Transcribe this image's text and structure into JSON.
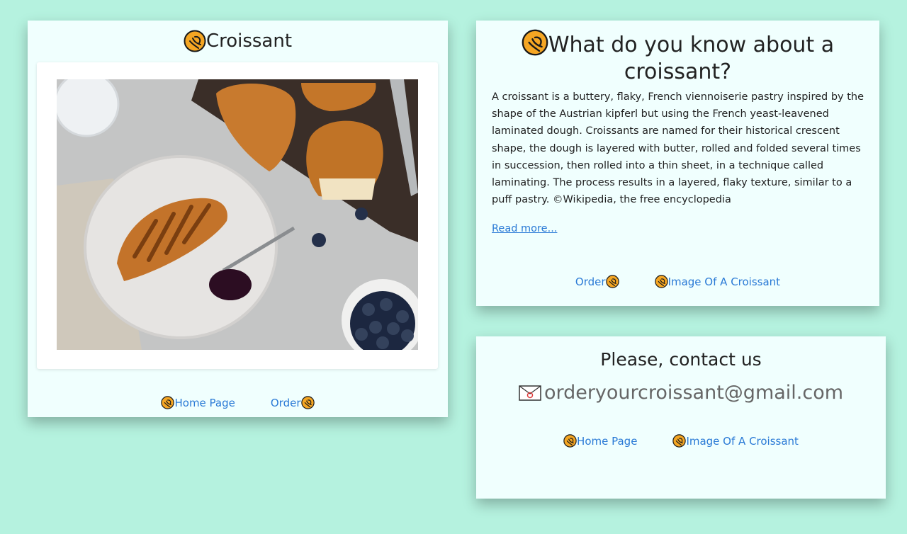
{
  "image_card": {
    "title": "Croissant",
    "links": {
      "home": "Home Page",
      "order": "Order"
    }
  },
  "info_card": {
    "title": "What do you know about a croissant?",
    "description": "A croissant is a buttery, flaky, French viennoiserie pastry inspired by the shape of the Austrian kipferl but using the French yeast-leavened laminated dough. Croissants are named for their historical crescent shape, the dough is layered with butter, rolled and folded several times in succession, then rolled into a thin sheet, in a technique called laminating. The process results in a layered, flaky texture, similar to a puff pastry. ©Wikipedia, the free encyclopedia",
    "read_more": "Read more...",
    "links": {
      "order": "Order",
      "image": "Image Of A Croissant"
    }
  },
  "contact_card": {
    "title": "Please, contact us",
    "email": "orderyourcroissant@gmail.com",
    "links": {
      "home": "Home Page",
      "image": "Image Of A Croissant"
    }
  },
  "colors": {
    "background": "#b5f2df",
    "card": "#f0fffe",
    "link": "#2a7ad6",
    "icon": "#f5a623"
  }
}
